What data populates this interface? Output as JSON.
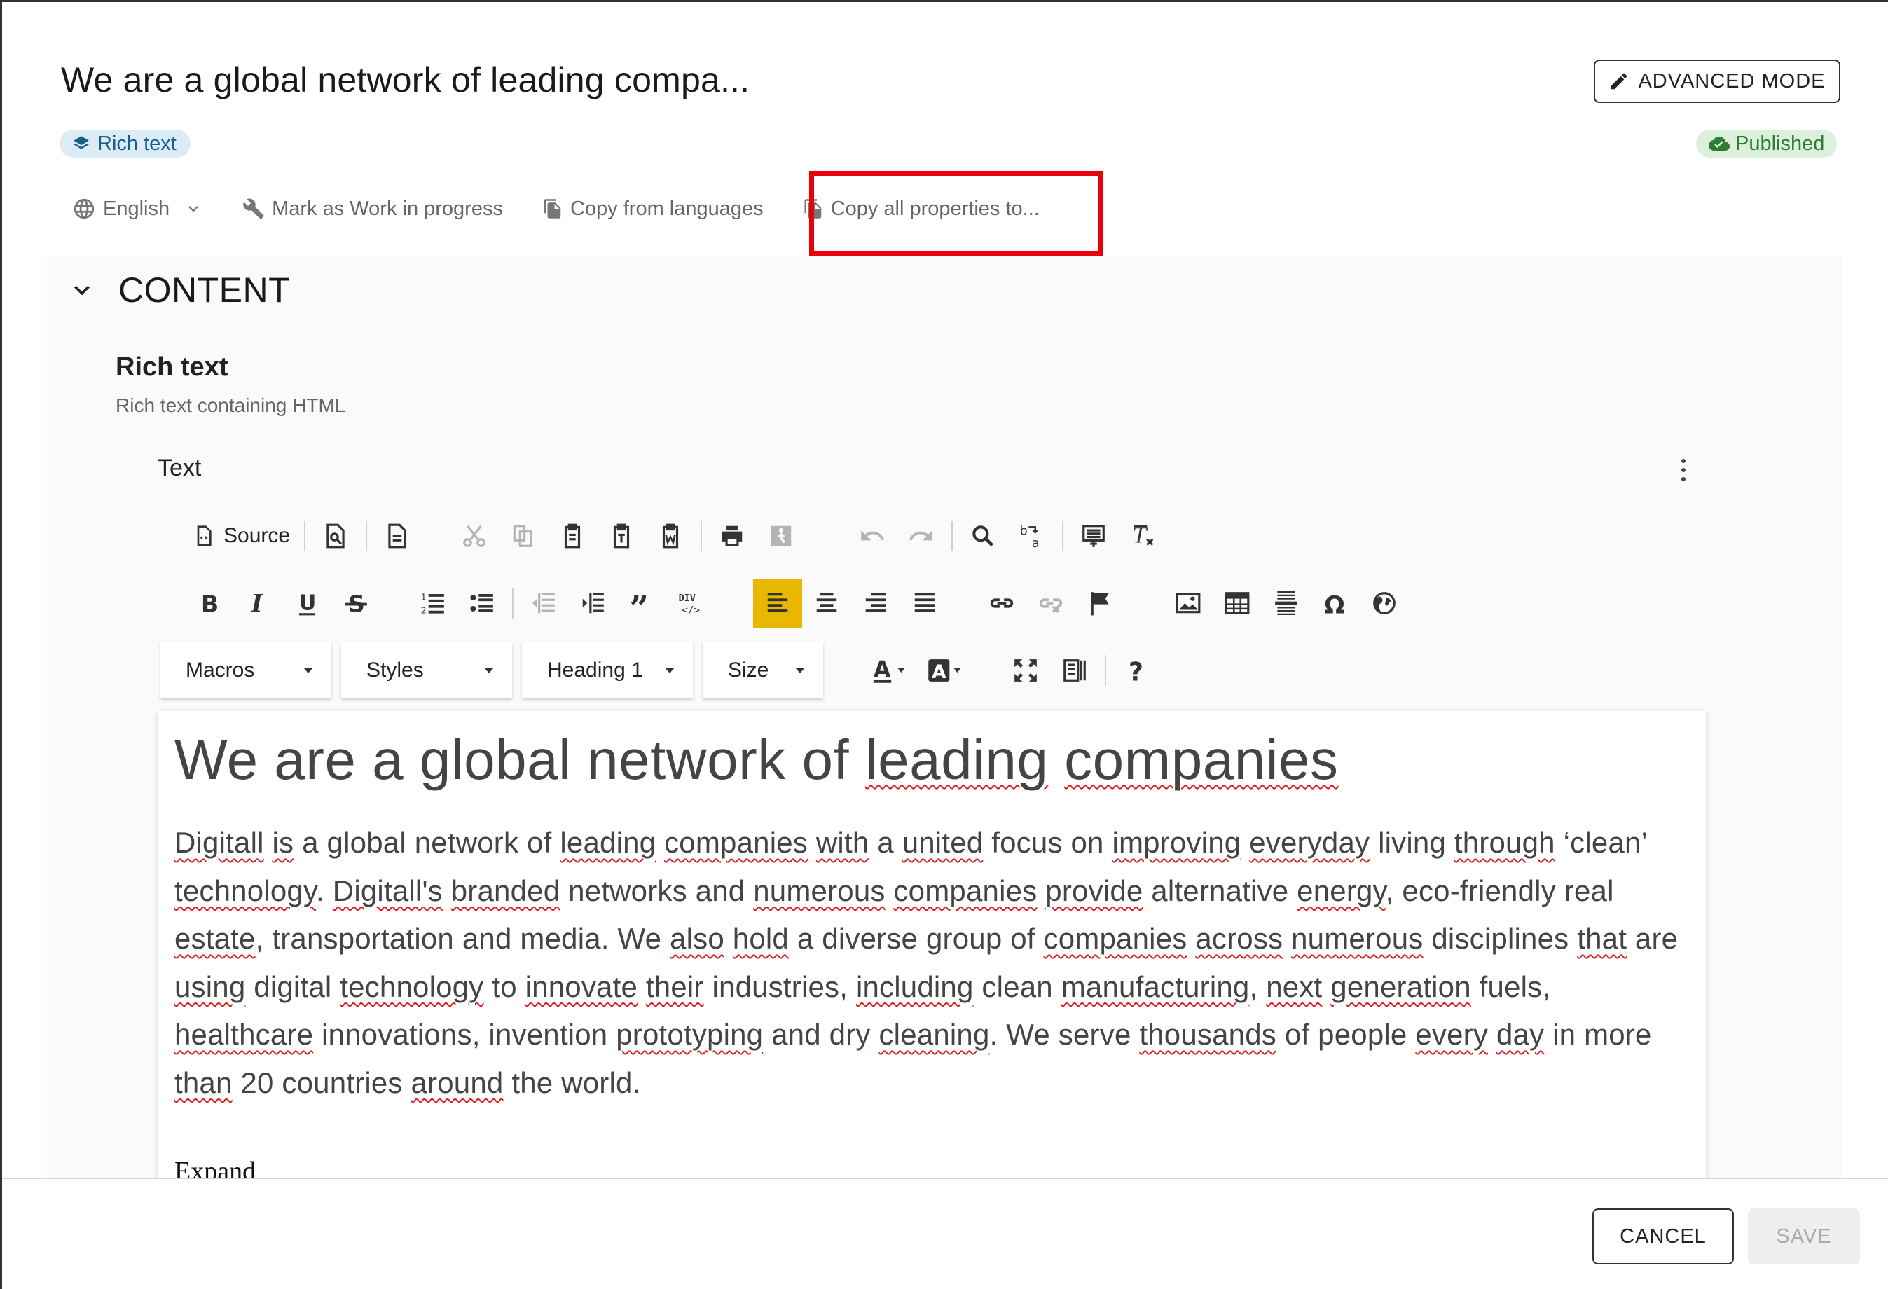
{
  "dialog": {
    "title": "We are a global network of leading compa...",
    "advanced_mode_label": "ADVANCED MODE",
    "type_chip": "Rich text",
    "status_chip": "Published"
  },
  "actions": {
    "language": "English",
    "work_in_progress": "Mark as Work in progress",
    "copy_from_languages": "Copy from languages",
    "copy_all_properties": "Copy all properties to..."
  },
  "section": {
    "title": "CONTENT"
  },
  "field": {
    "title": "Rich text",
    "subtitle": "Rich text containing HTML",
    "text_label": "Text"
  },
  "editor_toolbar": {
    "source_label": "Source",
    "combos": {
      "macros": "Macros",
      "styles": "Styles",
      "format": "Heading 1",
      "size": "Size"
    }
  },
  "editor_content": {
    "heading": [
      "We are a global network of ",
      "leading",
      " ",
      "companies"
    ],
    "paragraph": [
      {
        "t": "Digitall",
        "s": true
      },
      {
        "t": " ",
        "s": false
      },
      {
        "t": "is",
        "s": true
      },
      {
        "t": " a global network of ",
        "s": false
      },
      {
        "t": "leading",
        "s": true
      },
      {
        "t": " ",
        "s": false
      },
      {
        "t": "companies",
        "s": true
      },
      {
        "t": " ",
        "s": false
      },
      {
        "t": "with",
        "s": true
      },
      {
        "t": " a ",
        "s": false
      },
      {
        "t": "united",
        "s": true
      },
      {
        "t": " focus on ",
        "s": false
      },
      {
        "t": "improving",
        "s": true
      },
      {
        "t": " ",
        "s": false
      },
      {
        "t": "everyday",
        "s": true
      },
      {
        "t": " living ",
        "s": false
      },
      {
        "t": "through",
        "s": true
      },
      {
        "t": " ‘clean’ ",
        "s": false
      },
      {
        "t": "technology",
        "s": true
      },
      {
        "t": ". ",
        "s": false
      },
      {
        "t": "Digitall's",
        "s": true
      },
      {
        "t": " ",
        "s": false
      },
      {
        "t": "branded",
        "s": true
      },
      {
        "t": " networks and ",
        "s": false
      },
      {
        "t": "numerous",
        "s": true
      },
      {
        "t": " ",
        "s": false
      },
      {
        "t": "companies",
        "s": true
      },
      {
        "t": " ",
        "s": false
      },
      {
        "t": "provide",
        "s": true
      },
      {
        "t": " alternative ",
        "s": false
      },
      {
        "t": "energy",
        "s": true
      },
      {
        "t": ", eco-friendly real ",
        "s": false
      },
      {
        "t": "estate",
        "s": true
      },
      {
        "t": ", transportation and media. We ",
        "s": false
      },
      {
        "t": "also",
        "s": true
      },
      {
        "t": " ",
        "s": false
      },
      {
        "t": "hold",
        "s": true
      },
      {
        "t": " a diverse group of ",
        "s": false
      },
      {
        "t": "companies",
        "s": true
      },
      {
        "t": " ",
        "s": false
      },
      {
        "t": "across",
        "s": true
      },
      {
        "t": " ",
        "s": false
      },
      {
        "t": "numerous",
        "s": true
      },
      {
        "t": " disciplines ",
        "s": false
      },
      {
        "t": "that",
        "s": true
      },
      {
        "t": " are ",
        "s": false
      },
      {
        "t": "using",
        "s": true
      },
      {
        "t": " digital ",
        "s": false
      },
      {
        "t": "technology",
        "s": true
      },
      {
        "t": " to ",
        "s": false
      },
      {
        "t": "innovate",
        "s": true
      },
      {
        "t": " ",
        "s": false
      },
      {
        "t": "their",
        "s": true
      },
      {
        "t": " industries, ",
        "s": false
      },
      {
        "t": "including",
        "s": true
      },
      {
        "t": " clean ",
        "s": false
      },
      {
        "t": "manufacturing",
        "s": true
      },
      {
        "t": ", ",
        "s": false
      },
      {
        "t": "next",
        "s": true
      },
      {
        "t": " ",
        "s": false
      },
      {
        "t": "generation",
        "s": true
      },
      {
        "t": " fuels, ",
        "s": false
      },
      {
        "t": "healthcare",
        "s": true
      },
      {
        "t": " innovations, invention ",
        "s": false
      },
      {
        "t": "prototyping",
        "s": true
      },
      {
        "t": " and dry ",
        "s": false
      },
      {
        "t": "cleaning",
        "s": true
      },
      {
        "t": ". We serve ",
        "s": false
      },
      {
        "t": "thousands",
        "s": true
      },
      {
        "t": " of people ",
        "s": false
      },
      {
        "t": "every",
        "s": true
      },
      {
        "t": " ",
        "s": false
      },
      {
        "t": "day",
        "s": true
      },
      {
        "t": " in more ",
        "s": false
      },
      {
        "t": "than",
        "s": true
      },
      {
        "t": " 20 countries ",
        "s": false
      },
      {
        "t": "around",
        "s": true
      },
      {
        "t": " the world.",
        "s": false
      }
    ],
    "expand": "Expand"
  },
  "footer": {
    "cancel_label": "CANCEL",
    "save_label": "SAVE"
  },
  "colors": {
    "highlight_box": "#e8000a",
    "active_align": "#e9b600",
    "chip_rich_bg": "#dcecf7",
    "chip_published_bg": "#dcf0dc"
  }
}
